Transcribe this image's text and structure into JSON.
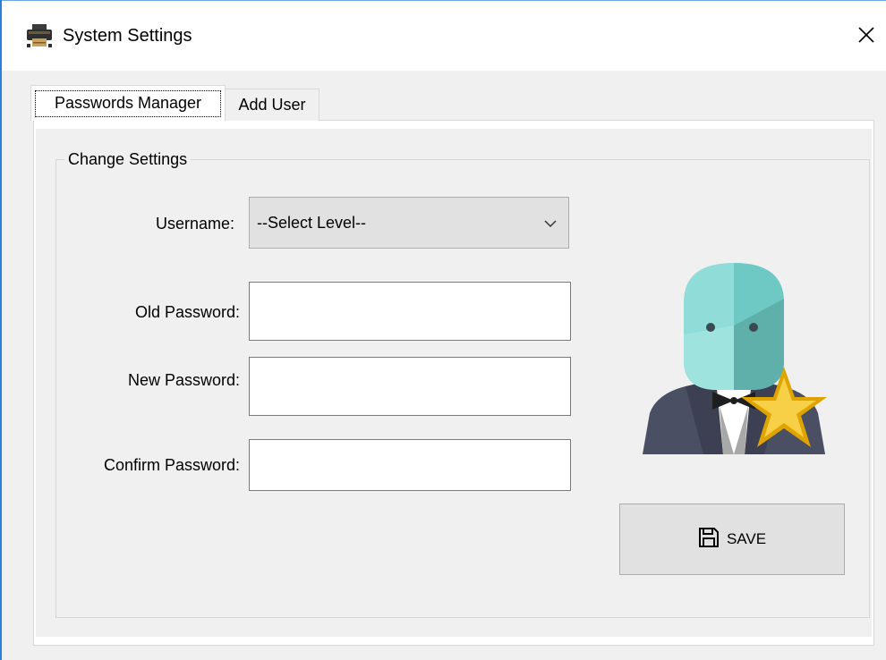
{
  "window": {
    "title": "System Settings",
    "icon": "printer-icon",
    "close_icon": "close-icon"
  },
  "tabs": [
    {
      "label": "Passwords Manager",
      "active": true
    },
    {
      "label": "Add User",
      "active": false
    }
  ],
  "group": {
    "legend": "Change Settings"
  },
  "form": {
    "username_label": "Username:",
    "username_value": "--Select Level--",
    "old_password_label": "Old Password:",
    "old_password_value": "",
    "new_password_label": "New Password:",
    "new_password_value": "",
    "confirm_password_label": "Confirm Password:",
    "confirm_password_value": ""
  },
  "avatar": {
    "icon": "admin-user-star-icon"
  },
  "save_button": {
    "label": "SAVE",
    "icon": "floppy-disk-icon"
  },
  "colors": {
    "accent_border": "#2b7fd6",
    "client_bg": "#f0f0f0",
    "button_bg": "#e1e1e1"
  }
}
